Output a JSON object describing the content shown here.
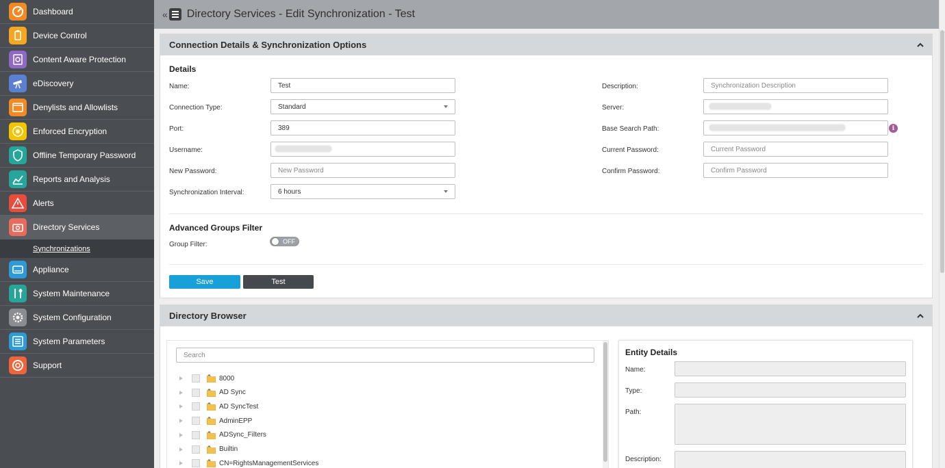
{
  "sidebar": {
    "items": [
      {
        "label": "Dashboard",
        "icon": "dashboard-icon",
        "color": "#f08a24"
      },
      {
        "label": "Device Control",
        "icon": "usb-device-icon",
        "color": "#f5a623"
      },
      {
        "label": "Content Aware Protection",
        "icon": "content-scan-icon",
        "color": "#8e6ac4"
      },
      {
        "label": "eDiscovery",
        "icon": "telescope-icon",
        "color": "#5b7fd1"
      },
      {
        "label": "Denylists and Allowlists",
        "icon": "list-window-icon",
        "color": "#f08a24"
      },
      {
        "label": "Enforced Encryption",
        "icon": "encryption-icon",
        "color": "#f5c400"
      },
      {
        "label": "Offline Temporary Password",
        "icon": "shield-icon",
        "color": "#26a69a"
      },
      {
        "label": "Reports and Analysis",
        "icon": "chart-icon",
        "color": "#26a69a"
      },
      {
        "label": "Alerts",
        "icon": "alert-icon",
        "color": "#e84c3d"
      },
      {
        "label": "Directory Services",
        "icon": "directory-icon",
        "color": "#e86c5d"
      },
      {
        "label": "Appliance",
        "icon": "appliance-icon",
        "color": "#2e9ad6"
      },
      {
        "label": "System Maintenance",
        "icon": "tools-icon",
        "color": "#26a69a"
      },
      {
        "label": "System Configuration",
        "icon": "gear-icon",
        "color": "#8a8d91"
      },
      {
        "label": "System Parameters",
        "icon": "parameters-icon",
        "color": "#2e9ad6"
      },
      {
        "label": "Support",
        "icon": "lifebuoy-icon",
        "color": "#f0643a"
      }
    ],
    "sub_item": "Synchronizations"
  },
  "header": {
    "collapse": "«",
    "title": "Directory Services - Edit Synchronization - Test"
  },
  "connection_panel": {
    "title": "Connection Details & Synchronization Options",
    "details_title": "Details",
    "fields": {
      "name_label": "Name:",
      "name_value": "Test",
      "connection_type_label": "Connection Type:",
      "connection_type_value": "Standard",
      "port_label": "Port:",
      "port_value": "389",
      "username_label": "Username:",
      "new_password_label": "New Password:",
      "new_password_placeholder": "New Password",
      "sync_interval_label": "Synchronization Interval:",
      "sync_interval_value": "6 hours",
      "description_label": "Description:",
      "description_placeholder": "Synchronization Description",
      "server_label": "Server:",
      "base_search_path_label": "Base Search Path:",
      "current_password_label": "Current Password:",
      "current_password_placeholder": "Current Password",
      "confirm_password_label": "Confirm Password:",
      "confirm_password_placeholder": "Confirm Password"
    },
    "advanced_title": "Advanced Groups Filter",
    "group_filter_label": "Group Filter:",
    "group_filter_state": "OFF",
    "save_label": "Save",
    "test_label": "Test",
    "save_color": "#1aa0d8",
    "test_color": "#45484d"
  },
  "directory_browser": {
    "title": "Directory Browser",
    "search_placeholder": "Search",
    "tree": [
      "8000",
      "AD Sync",
      "AD SyncTest",
      "AdminEPP",
      "ADSync_Filters",
      "Builtin",
      "CN=RightsManagementServices"
    ],
    "entity_title": "Entity Details",
    "entity_name_label": "Name:",
    "entity_type_label": "Type:",
    "entity_path_label": "Path:",
    "entity_description_label": "Description:"
  }
}
